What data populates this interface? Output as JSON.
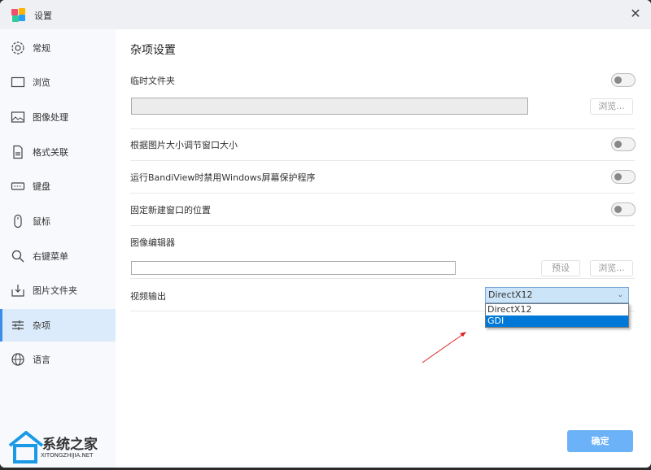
{
  "window": {
    "title": "设置",
    "close": "✕"
  },
  "sidebar": {
    "items": [
      {
        "label": "常规",
        "icon": "gear-icon"
      },
      {
        "label": "浏览",
        "icon": "frame-icon"
      },
      {
        "label": "图像处理",
        "icon": "image-icon"
      },
      {
        "label": "格式关联",
        "icon": "document-icon"
      },
      {
        "label": "键盘",
        "icon": "keyboard-icon"
      },
      {
        "label": "鼠标",
        "icon": "mouse-icon"
      },
      {
        "label": "右键菜单",
        "icon": "search-icon"
      },
      {
        "label": "图片文件夹",
        "icon": "download-icon"
      },
      {
        "label": "杂项",
        "icon": "sliders-icon",
        "active": true
      },
      {
        "label": "语言",
        "icon": "globe-icon"
      }
    ]
  },
  "main": {
    "title": "杂项设置",
    "temp_folder": {
      "label": "临时文件夹",
      "path": "",
      "browse": "浏览..."
    },
    "resize_window": {
      "label": "根据图片大小调节窗口大小"
    },
    "disable_screensaver": {
      "label": "运行BandiView时禁用Windows屏幕保护程序"
    },
    "fix_window_pos": {
      "label": "固定新建窗口的位置"
    },
    "image_editor": {
      "label": "图像编辑器",
      "path": "",
      "preset": "预设",
      "browse": "浏览..."
    },
    "video_output": {
      "label": "视频输出",
      "selected": "DirectX12",
      "options": [
        "DirectX12",
        "GDI"
      ],
      "highlighted": "GDI"
    }
  },
  "footer": {
    "ok": "确定"
  },
  "watermark": {
    "text": "系统之家",
    "url": "XITONGZHIJIA.NET"
  },
  "colors": {
    "accent": "#0078d7",
    "ok_button": "#6cb2f8",
    "active_nav": "#dcebfb",
    "annotation_arrow": "#e02020"
  }
}
